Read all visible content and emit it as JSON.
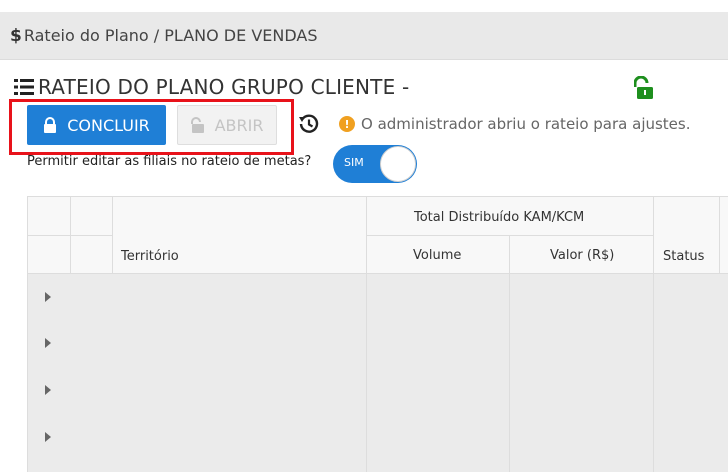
{
  "breadcrumb": {
    "text": "Rateio do Plano / PLANO DE VENDAS"
  },
  "header": {
    "title": "RATEIO DO PLANO GRUPO CLIENTE -"
  },
  "toolbar": {
    "concluir_label": "CONCLUIR",
    "abrir_label": "ABRIR",
    "info_message": "O administrador abriu o rateio para ajustes."
  },
  "permission": {
    "label": "Permitir editar as filiais no rateio de metas?",
    "toggle_text": "SIM"
  },
  "grid": {
    "group_header": "Total Distribuído KAM/KCM",
    "columns": {
      "territorio": "Território",
      "volume": "Volume",
      "valor": "Valor (R$)",
      "status": "Status"
    },
    "row_count": 4
  },
  "colors": {
    "accent": "#1f7fd6",
    "lock_open": "#1e8f1e",
    "warning": "#f0a020",
    "highlight": "#e8121a"
  }
}
